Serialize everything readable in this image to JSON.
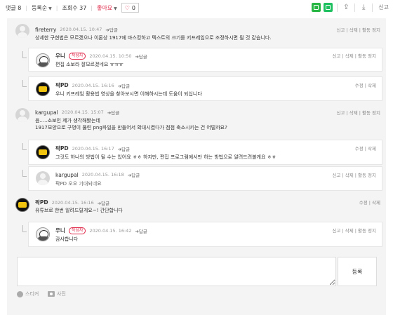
{
  "toolbar": {
    "comments_label": "댓글 8",
    "sort_label": "등록순",
    "views_label": "조회수 37",
    "like_label": "좋아요",
    "like_count": "0",
    "report_label": "신고"
  },
  "comments": [
    {
      "author": "fireterry",
      "date": "2020.04.15. 10:47",
      "reply_label": "답글",
      "text": "상세한 구현법은 모르겠으나 이론상 1917에 마스킹하고 텍스트의 크기를 키프레임으로 조정하시면 될 것 같습니다.",
      "actions": "신고 | 삭제 | 활동 정지"
    },
    {
      "author": "우니",
      "badge": "작성자",
      "date": "2020.04.15. 10:50",
      "reply_label": "답글",
      "text": "편집 소보라 잘모르겠네요 ㅠㅠㅠ",
      "actions": "신고 | 삭제 | 활동 정지"
    },
    {
      "author": "팍PD",
      "date": "2020.04.15. 16:16",
      "reply_label": "답글",
      "text": "우니 키프레임 활용법 영상을 찾아보시면 이해하시는데 도움이 되십니다",
      "actions": "수정 | 삭제"
    },
    {
      "author": "kargupal",
      "date": "2020.04.15. 15:07",
      "reply_label": "답글",
      "text_lines": [
        "음.....소보인 제가 생각해봤는데",
        "1917모양으로 구멍이 뚫린 png파일을 만들어서 확대시켰다가 점점 축소시키는 건 어떨까요?"
      ],
      "actions": "신고 | 삭제 | 활동 정지"
    },
    {
      "author": "팍PD",
      "date": "2020.04.15. 16:17",
      "reply_label": "답글",
      "text": "그것도 하나의 방법이 될 수는 있어요 ㅎㅎ 하지만, 편집 프로그램에서만 하는 방법으로 알려드려볼게요 ㅎㅎ",
      "actions": "수정 | 삭제"
    },
    {
      "author": "kargupal",
      "date": "2020.04.15. 16:18",
      "reply_label": "답글",
      "text": "팍PD 오오 기대되네요",
      "actions": "신고 | 삭제 | 활동 정지"
    },
    {
      "author": "팍PD",
      "date": "2020.04.15. 16:16",
      "reply_label": "답글",
      "text": "유튜브로 한번 알려드릴게요~! 간단합니다",
      "actions": "수정 | 삭제"
    },
    {
      "author": "우니",
      "badge": "작성자",
      "date": "2020.04.15. 16:42",
      "reply_label": "답글",
      "text": "감사합니다",
      "actions": "신고 | 삭제 | 활동 정지"
    }
  ],
  "write": {
    "submit_label": "등록",
    "sticker_label": "스티커",
    "photo_label": "사진"
  },
  "icons": {
    "sort_caret": "caret-down-icon",
    "heart": "heart-icon",
    "share": "share-icon",
    "download": "download-icon",
    "reply_arrow": "reply-arrow-icon"
  },
  "colors": {
    "accent_red": "#e0294a",
    "green": "#27b543",
    "panel_bg": "#f4f4f4"
  }
}
